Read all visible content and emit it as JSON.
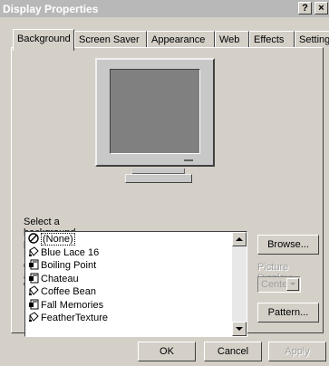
{
  "window": {
    "title": "Display Properties",
    "help_label": "?",
    "close_label": "×"
  },
  "tabs": [
    {
      "label": "Background",
      "active": true
    },
    {
      "label": "Screen Saver",
      "active": false
    },
    {
      "label": "Appearance",
      "active": false
    },
    {
      "label": "Web",
      "active": false
    },
    {
      "label": "Effects",
      "active": false
    },
    {
      "label": "Settings",
      "active": false
    }
  ],
  "background": {
    "wallpaper_label": "Select a background picture or HTML document as Wallpaper:",
    "wallpapers": [
      {
        "label": "(None)",
        "icon": "none-icon",
        "selected": true
      },
      {
        "label": "Blue Lace 16",
        "icon": "paint-bucket-icon",
        "selected": false
      },
      {
        "label": "Boiling Point",
        "icon": "html-document-icon",
        "selected": false
      },
      {
        "label": "Chateau",
        "icon": "html-document-icon",
        "selected": false
      },
      {
        "label": "Coffee Bean",
        "icon": "paint-bucket-icon",
        "selected": false
      },
      {
        "label": "Fall Memories",
        "icon": "html-document-icon",
        "selected": false
      },
      {
        "label": "FeatherTexture",
        "icon": "paint-bucket-icon",
        "selected": false
      }
    ],
    "browse_label": "Browse...",
    "picture_display_label": "Picture Display:",
    "picture_display_value": "Center",
    "pattern_label": "Pattern..."
  },
  "buttons": {
    "ok_label": "OK",
    "cancel_label": "Cancel",
    "apply_label": "Apply"
  }
}
